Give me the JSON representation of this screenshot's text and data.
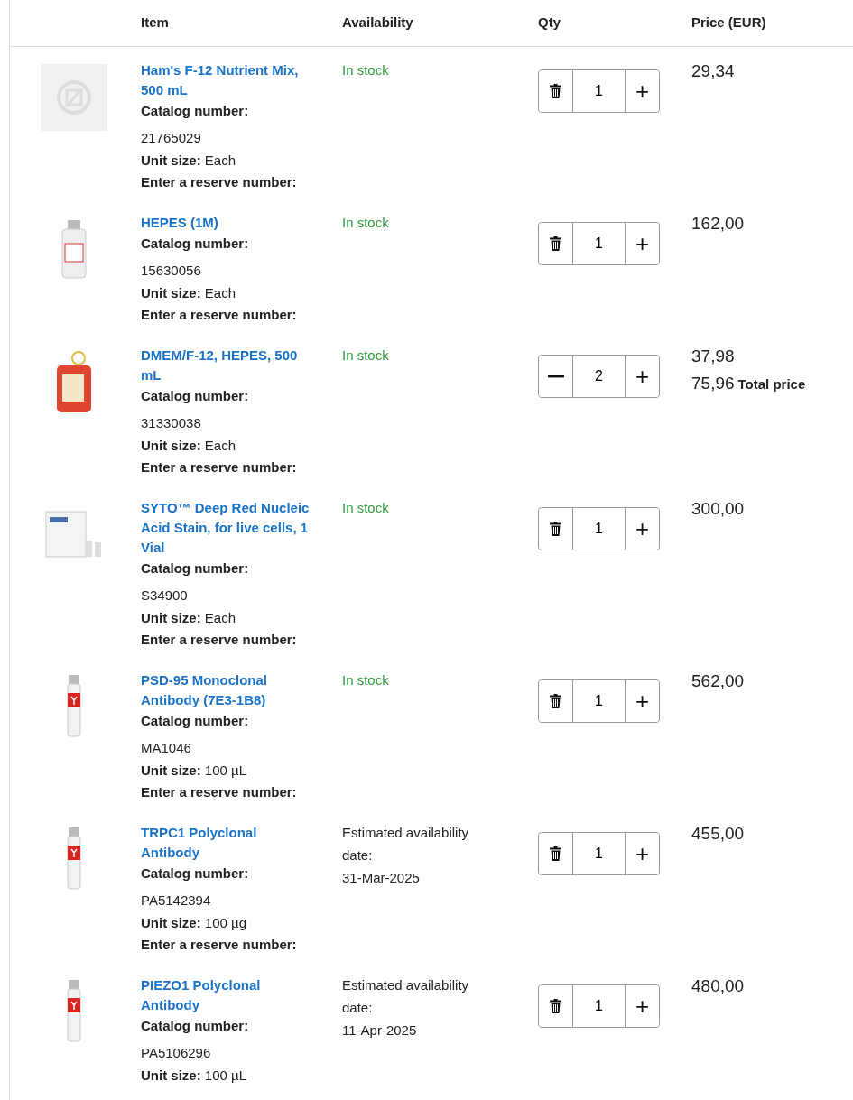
{
  "columns": [
    "Item",
    "Availability",
    "Qty",
    "Price (EUR)"
  ],
  "items": [
    {
      "image": {
        "kind": "placeholder"
      },
      "title": "Ham's F-12 Nutrient Mix, 500 mL",
      "catalog_label": "Catalog number:",
      "catalog": "21765029",
      "unit_label": "Unit size:",
      "unit": "Each",
      "reserve_label": "Enter a reserve number:",
      "availability": {
        "kind": "stock",
        "text": "In stock"
      },
      "qty_remove": {
        "kind": "trash"
      },
      "qty": "1",
      "qty_add": "+",
      "price": "29,34"
    },
    {
      "image": {
        "kind": "bottle"
      },
      "title": "HEPES (1M)",
      "catalog_label": "Catalog number:",
      "catalog": "15630056",
      "unit_label": "Unit size:",
      "unit": "Each",
      "reserve_label": "Enter a reserve number:",
      "availability": {
        "kind": "stock",
        "text": "In stock"
      },
      "qty_remove": {
        "kind": "trash"
      },
      "qty": "1",
      "qty_add": "+",
      "price": "162,00"
    },
    {
      "image": {
        "kind": "flask"
      },
      "title": "DMEM/F-12, HEPES, 500 mL",
      "catalog_label": "Catalog number:",
      "catalog": "31330038",
      "unit_label": "Unit size:",
      "unit": "Each",
      "reserve_label": "Enter a reserve number:",
      "availability": {
        "kind": "stock",
        "text": "In stock"
      },
      "qty_remove": {
        "kind": "minus"
      },
      "qty": "2",
      "qty_add": "+",
      "price": "37,98",
      "total": "75,96",
      "total_label": "Total price"
    },
    {
      "image": {
        "kind": "kit"
      },
      "title": "SYTO™ Deep Red Nucleic Acid Stain, for live cells, 1 Vial",
      "catalog_label": "Catalog number:",
      "catalog": "S34900",
      "unit_label": "Unit size:",
      "unit": "Each",
      "reserve_label": "Enter a reserve number:",
      "availability": {
        "kind": "stock",
        "text": "In stock"
      },
      "qty_remove": {
        "kind": "trash"
      },
      "qty": "1",
      "qty_add": "+",
      "price": "300,00"
    },
    {
      "image": {
        "kind": "tube"
      },
      "title": "PSD-95 Monoclonal Antibody (7E3-1B8)",
      "catalog_label": "Catalog number:",
      "catalog": "MA1046",
      "unit_label": "Unit size:",
      "unit": "100 µL",
      "reserve_label": "Enter a reserve number:",
      "availability": {
        "kind": "stock",
        "text": "In stock"
      },
      "qty_remove": {
        "kind": "trash"
      },
      "qty": "1",
      "qty_add": "+",
      "price": "562,00"
    },
    {
      "image": {
        "kind": "tube"
      },
      "title": "TRPC1 Polyclonal Antibody",
      "catalog_label": "Catalog number:",
      "catalog": "PA5142394",
      "unit_label": "Unit size:",
      "unit": "100 µg",
      "reserve_label": "Enter a reserve number:",
      "availability": {
        "kind": "estimated",
        "text": "Estimated availability date:",
        "date": "31-Mar-2025"
      },
      "qty_remove": {
        "kind": "trash"
      },
      "qty": "1",
      "qty_add": "+",
      "price": "455,00"
    },
    {
      "image": {
        "kind": "tube"
      },
      "title": "PIEZO1 Polyclonal Antibody",
      "catalog_label": "Catalog number:",
      "catalog": "PA5106296",
      "unit_label": "Unit size:",
      "unit": "100 µL",
      "availability": {
        "kind": "estimated",
        "text": "Estimated availability date:",
        "date": "11-Apr-2025"
      },
      "qty_remove": {
        "kind": "trash"
      },
      "qty": "1",
      "qty_add": "+",
      "price": "480,00"
    }
  ]
}
